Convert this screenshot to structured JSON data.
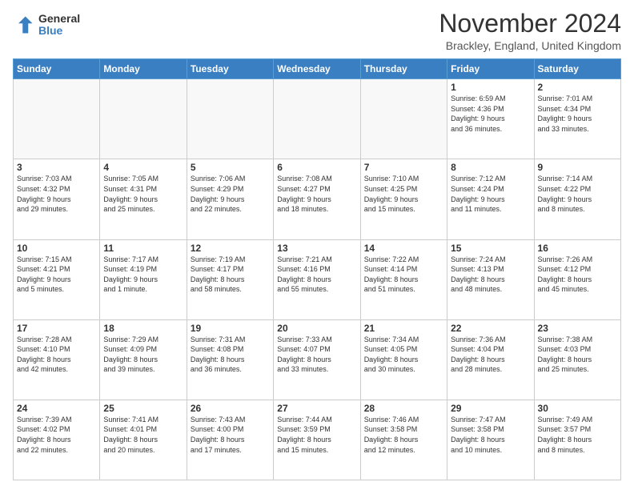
{
  "logo": {
    "general": "General",
    "blue": "Blue"
  },
  "title": "November 2024",
  "location": "Brackley, England, United Kingdom",
  "days_header": [
    "Sunday",
    "Monday",
    "Tuesday",
    "Wednesday",
    "Thursday",
    "Friday",
    "Saturday"
  ],
  "weeks": [
    [
      {
        "day": "",
        "info": ""
      },
      {
        "day": "",
        "info": ""
      },
      {
        "day": "",
        "info": ""
      },
      {
        "day": "",
        "info": ""
      },
      {
        "day": "",
        "info": ""
      },
      {
        "day": "1",
        "info": "Sunrise: 6:59 AM\nSunset: 4:36 PM\nDaylight: 9 hours\nand 36 minutes."
      },
      {
        "day": "2",
        "info": "Sunrise: 7:01 AM\nSunset: 4:34 PM\nDaylight: 9 hours\nand 33 minutes."
      }
    ],
    [
      {
        "day": "3",
        "info": "Sunrise: 7:03 AM\nSunset: 4:32 PM\nDaylight: 9 hours\nand 29 minutes."
      },
      {
        "day": "4",
        "info": "Sunrise: 7:05 AM\nSunset: 4:31 PM\nDaylight: 9 hours\nand 25 minutes."
      },
      {
        "day": "5",
        "info": "Sunrise: 7:06 AM\nSunset: 4:29 PM\nDaylight: 9 hours\nand 22 minutes."
      },
      {
        "day": "6",
        "info": "Sunrise: 7:08 AM\nSunset: 4:27 PM\nDaylight: 9 hours\nand 18 minutes."
      },
      {
        "day": "7",
        "info": "Sunrise: 7:10 AM\nSunset: 4:25 PM\nDaylight: 9 hours\nand 15 minutes."
      },
      {
        "day": "8",
        "info": "Sunrise: 7:12 AM\nSunset: 4:24 PM\nDaylight: 9 hours\nand 11 minutes."
      },
      {
        "day": "9",
        "info": "Sunrise: 7:14 AM\nSunset: 4:22 PM\nDaylight: 9 hours\nand 8 minutes."
      }
    ],
    [
      {
        "day": "10",
        "info": "Sunrise: 7:15 AM\nSunset: 4:21 PM\nDaylight: 9 hours\nand 5 minutes."
      },
      {
        "day": "11",
        "info": "Sunrise: 7:17 AM\nSunset: 4:19 PM\nDaylight: 9 hours\nand 1 minute."
      },
      {
        "day": "12",
        "info": "Sunrise: 7:19 AM\nSunset: 4:17 PM\nDaylight: 8 hours\nand 58 minutes."
      },
      {
        "day": "13",
        "info": "Sunrise: 7:21 AM\nSunset: 4:16 PM\nDaylight: 8 hours\nand 55 minutes."
      },
      {
        "day": "14",
        "info": "Sunrise: 7:22 AM\nSunset: 4:14 PM\nDaylight: 8 hours\nand 51 minutes."
      },
      {
        "day": "15",
        "info": "Sunrise: 7:24 AM\nSunset: 4:13 PM\nDaylight: 8 hours\nand 48 minutes."
      },
      {
        "day": "16",
        "info": "Sunrise: 7:26 AM\nSunset: 4:12 PM\nDaylight: 8 hours\nand 45 minutes."
      }
    ],
    [
      {
        "day": "17",
        "info": "Sunrise: 7:28 AM\nSunset: 4:10 PM\nDaylight: 8 hours\nand 42 minutes."
      },
      {
        "day": "18",
        "info": "Sunrise: 7:29 AM\nSunset: 4:09 PM\nDaylight: 8 hours\nand 39 minutes."
      },
      {
        "day": "19",
        "info": "Sunrise: 7:31 AM\nSunset: 4:08 PM\nDaylight: 8 hours\nand 36 minutes."
      },
      {
        "day": "20",
        "info": "Sunrise: 7:33 AM\nSunset: 4:07 PM\nDaylight: 8 hours\nand 33 minutes."
      },
      {
        "day": "21",
        "info": "Sunrise: 7:34 AM\nSunset: 4:05 PM\nDaylight: 8 hours\nand 30 minutes."
      },
      {
        "day": "22",
        "info": "Sunrise: 7:36 AM\nSunset: 4:04 PM\nDaylight: 8 hours\nand 28 minutes."
      },
      {
        "day": "23",
        "info": "Sunrise: 7:38 AM\nSunset: 4:03 PM\nDaylight: 8 hours\nand 25 minutes."
      }
    ],
    [
      {
        "day": "24",
        "info": "Sunrise: 7:39 AM\nSunset: 4:02 PM\nDaylight: 8 hours\nand 22 minutes."
      },
      {
        "day": "25",
        "info": "Sunrise: 7:41 AM\nSunset: 4:01 PM\nDaylight: 8 hours\nand 20 minutes."
      },
      {
        "day": "26",
        "info": "Sunrise: 7:43 AM\nSunset: 4:00 PM\nDaylight: 8 hours\nand 17 minutes."
      },
      {
        "day": "27",
        "info": "Sunrise: 7:44 AM\nSunset: 3:59 PM\nDaylight: 8 hours\nand 15 minutes."
      },
      {
        "day": "28",
        "info": "Sunrise: 7:46 AM\nSunset: 3:58 PM\nDaylight: 8 hours\nand 12 minutes."
      },
      {
        "day": "29",
        "info": "Sunrise: 7:47 AM\nSunset: 3:58 PM\nDaylight: 8 hours\nand 10 minutes."
      },
      {
        "day": "30",
        "info": "Sunrise: 7:49 AM\nSunset: 3:57 PM\nDaylight: 8 hours\nand 8 minutes."
      }
    ]
  ]
}
